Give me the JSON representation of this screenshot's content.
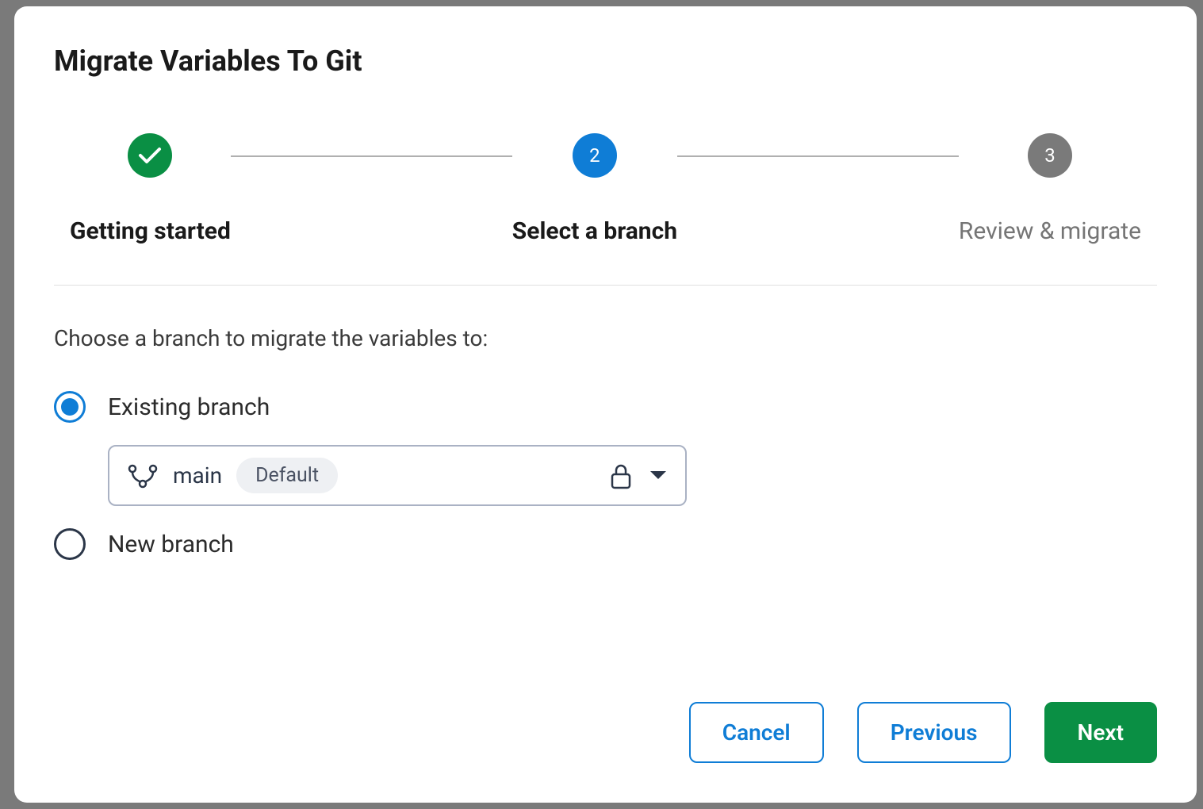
{
  "modal": {
    "title": "Migrate Variables To Git"
  },
  "stepper": {
    "steps": [
      {
        "label": "Getting started",
        "state": "completed"
      },
      {
        "label": "Select a branch",
        "number": "2",
        "state": "active"
      },
      {
        "label": "Review & migrate",
        "number": "3",
        "state": "pending"
      }
    ]
  },
  "prompt": "Choose a branch to migrate the variables to:",
  "branchOptions": {
    "existing": {
      "label": "Existing branch",
      "selected": true,
      "selectedBranch": "main",
      "badge": "Default"
    },
    "newBranch": {
      "label": "New branch",
      "selected": false
    }
  },
  "buttons": {
    "cancel": "Cancel",
    "previous": "Previous",
    "next": "Next"
  }
}
